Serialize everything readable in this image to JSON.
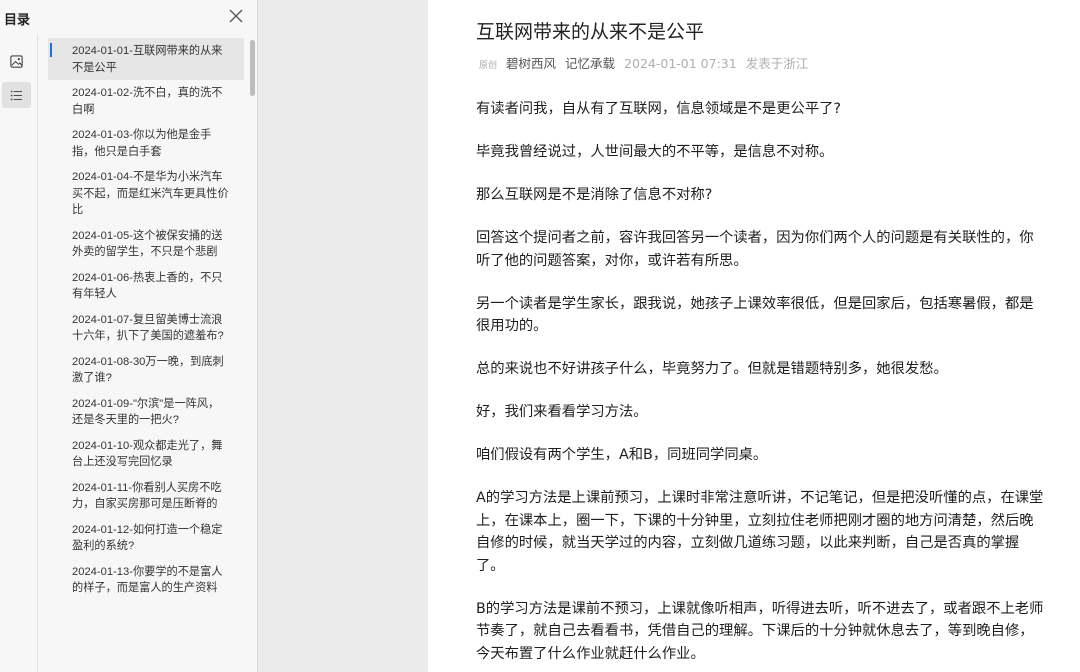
{
  "toc": {
    "title": "目录",
    "items": [
      {
        "label": "2024-01-01-互联网带来的从来不是公平"
      },
      {
        "label": "2024-01-02-洗不白，真的洗不白啊"
      },
      {
        "label": "2024-01-03-你以为他是金手指，他只是白手套"
      },
      {
        "label": "2024-01-04-不是华为小米汽车买不起，而是红米汽车更具性价比"
      },
      {
        "label": "2024-01-05-这个被保安捅的送外卖的留学生，不只是个悲剧"
      },
      {
        "label": "2024-01-06-热衷上香的，不只有年轻人"
      },
      {
        "label": "2024-01-07-复旦留美博士流浪十六年，扒下了美国的遮羞布?"
      },
      {
        "label": "2024-01-08-30万一晚，到底刺激了谁?"
      },
      {
        "label": "2024-01-09-\"尔滨\"是一阵风，还是冬天里的一把火?"
      },
      {
        "label": "2024-01-10-观众都走光了，舞台上还没写完回忆录"
      },
      {
        "label": "2024-01-11-你看别人买房不吃力，自家买房那可是压断脊的"
      },
      {
        "label": "2024-01-12-如何打造一个稳定盈利的系统?"
      },
      {
        "label": "2024-01-13-你要学的不是富人的样子，而是富人的生产资料"
      }
    ]
  },
  "article": {
    "title": "互联网带来的从来不是公平",
    "original_tag": "原创",
    "author": "碧树西风",
    "account": "记忆承载",
    "date": "2024-01-01 07:31",
    "location": "发表于浙江",
    "paragraphs": [
      "有读者问我，自从有了互联网，信息领域是不是更公平了?",
      "毕竟我曾经说过，人世间最大的不平等，是信息不对称。",
      "那么互联网是不是消除了信息不对称?",
      "回答这个提问者之前，容许我回答另一个读者，因为你们两个人的问题是有关联性的，你听了他的问题答案，对你，或许若有所思。",
      "另一个读者是学生家长，跟我说，她孩子上课效率很低，但是回家后，包括寒暑假，都是很用功的。",
      "总的来说也不好讲孩子什么，毕竟努力了。但就是错题特别多，她很发愁。",
      "好，我们来看看学习方法。",
      "咱们假设有两个学生，A和B，同班同学同桌。",
      "A的学习方法是上课前预习，上课时非常注意听讲，不记笔记，但是把没听懂的点，在课堂上，在课本上，圈一下，下课的十分钟里，立刻拉住老师把刚才圈的地方问清楚，然后晚自修的时候，就当天学过的内容，立刻做几道练习题，以此来判断，自己是否真的掌握了。",
      "B的学习方法是课前不预习，上课就像听相声，听得进去听，听不进去了，或者跟不上老师节奏了，就自己去看看书，凭借自己的理解。下课后的十分钟就休息去了，等到晚自修，今天布置了什么作业就赶什么作业。"
    ]
  }
}
